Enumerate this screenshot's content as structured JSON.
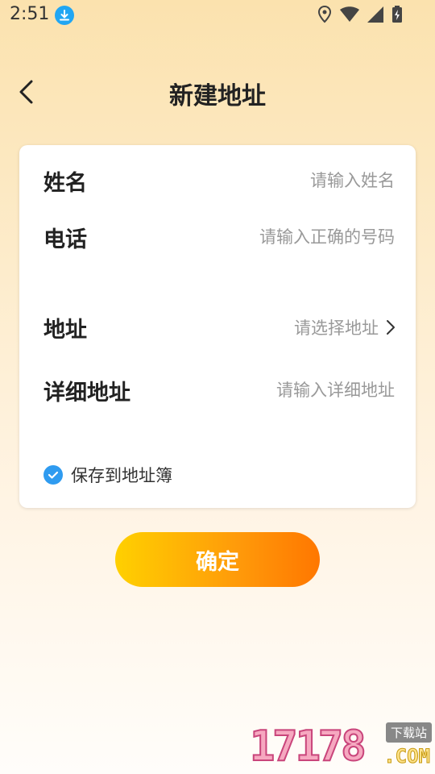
{
  "status_bar": {
    "time": "2:51",
    "icons": [
      "download-icon",
      "location-icon",
      "wifi-icon",
      "signal-icon",
      "battery-icon"
    ]
  },
  "header": {
    "title": "新建地址",
    "back_icon": "chevron-left-icon"
  },
  "form": {
    "name": {
      "label": "姓名",
      "placeholder": "请输入姓名"
    },
    "phone": {
      "label": "电话",
      "placeholder": "请输入正确的号码"
    },
    "address": {
      "label": "地址",
      "placeholder": "请选择地址",
      "icon": "chevron-right-icon"
    },
    "detail": {
      "label": "详细地址",
      "placeholder": "请输入详细地址"
    },
    "save_to_book": {
      "label": "保存到地址簿",
      "checked": true
    }
  },
  "confirm_button": {
    "label": "确定"
  },
  "watermark": {
    "number": "17178",
    "tag": "下载站",
    "suffix": ".COM"
  },
  "colors": {
    "accent_blue": "#2f9bf0",
    "button_start": "#ffd000",
    "button_end": "#ff7700",
    "placeholder": "#999999"
  }
}
